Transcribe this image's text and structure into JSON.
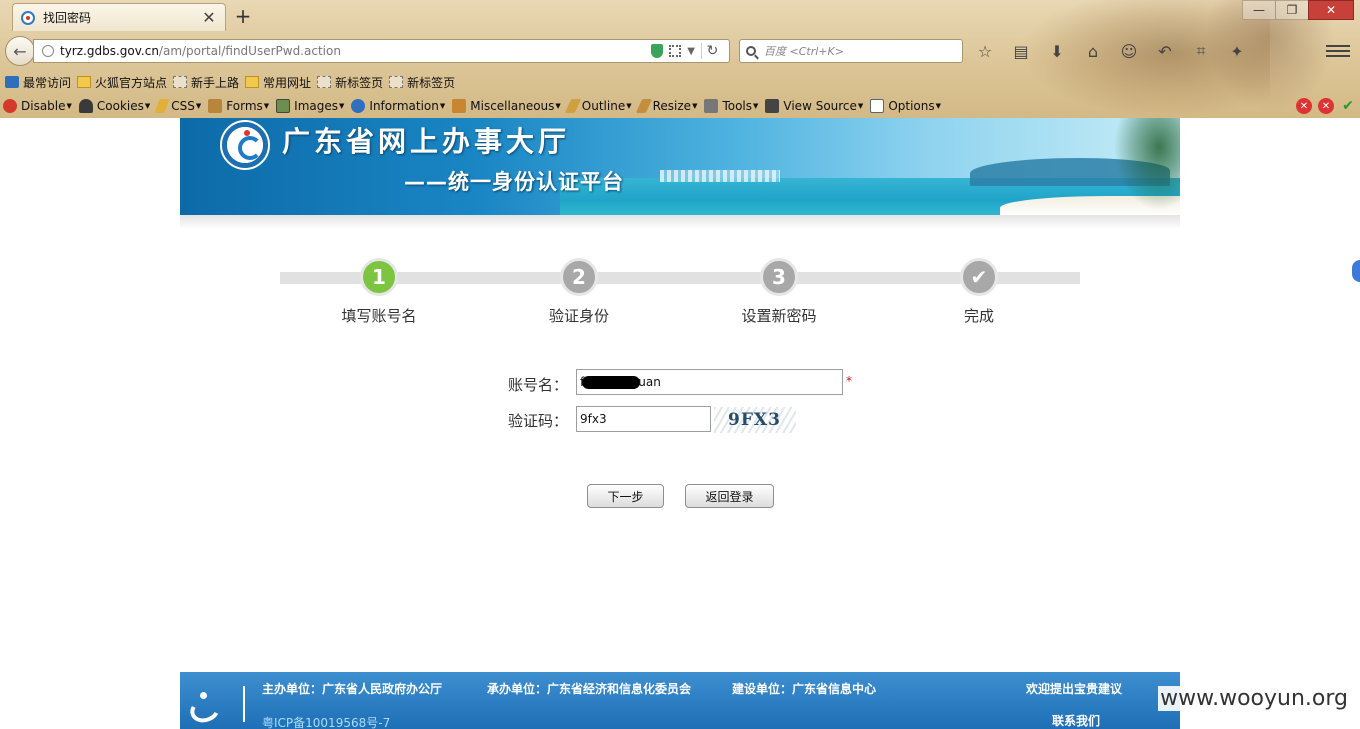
{
  "browser": {
    "tab_title": "找回密码",
    "tab_close": "✕",
    "new_tab": "+",
    "url_domain": "tyrz.gdbs.gov.cn",
    "url_path": "/am/portal/findUserPwd.action",
    "search_placeholder": "百度 <Ctrl+K>",
    "window_buttons": [
      "—",
      "❐",
      "✕"
    ]
  },
  "bookmarks": [
    {
      "label": "最常访问",
      "icon": "star-icon"
    },
    {
      "label": "火狐官方站点",
      "icon": "folder-icon"
    },
    {
      "label": "新手上路",
      "icon": "page-icon"
    },
    {
      "label": "常用网址",
      "icon": "folder-icon"
    },
    {
      "label": "新标签页",
      "icon": "page-icon"
    },
    {
      "label": "新标签页",
      "icon": "page-icon"
    }
  ],
  "devbar": [
    {
      "label": "Disable",
      "color": "#d33a2c"
    },
    {
      "label": "Cookies",
      "color": "#3a3a3a"
    },
    {
      "label": "CSS",
      "color": "#e0b03a"
    },
    {
      "label": "Forms",
      "color": "#b8863b"
    },
    {
      "label": "Images",
      "color": "#6c8f4f"
    },
    {
      "label": "Information",
      "color": "#2f6fc0"
    },
    {
      "label": "Miscellaneous",
      "color": "#c7862f"
    },
    {
      "label": "Outline",
      "color": "#d0a040"
    },
    {
      "label": "Resize",
      "color": "#c48f3c"
    },
    {
      "label": "Tools",
      "color": "#777777"
    },
    {
      "label": "View Source",
      "color": "#444444"
    },
    {
      "label": "Options",
      "color": "#556677"
    }
  ],
  "banner": {
    "title": "广东省网上办事大厅",
    "subtitle": "——统一身份认证平台"
  },
  "steps": [
    {
      "num": "1",
      "label": "填写账号名"
    },
    {
      "num": "2",
      "label": "验证身份"
    },
    {
      "num": "3",
      "label": "设置新密码"
    },
    {
      "num": "✔",
      "label": "完成"
    }
  ],
  "form": {
    "account_label": "账号名：",
    "account_value_start": "f",
    "account_value_end": "uan",
    "required_mark": "*",
    "captcha_label": "验证码：",
    "captcha_value": "9fx3",
    "captcha_image_text": "9FX3",
    "next_button": "下一步",
    "back_button": "返回登录"
  },
  "footer": {
    "sponsor": "主办单位：广东省人民政府办公厅",
    "organizer": "承办单位：广东省经济和信息化委员会",
    "builder": "建设单位：广东省信息中心",
    "feedback": "欢迎提出宝贵建议",
    "contact": "联系我们",
    "icp": "粤ICP备10019568号-7"
  },
  "watermark": "www.wooyun.org",
  "colors": {
    "active_step": "#7cc540",
    "inactive_step": "#a8a8a8",
    "footer_blue": "#1e6fb6",
    "required_red": "#c8161d"
  }
}
